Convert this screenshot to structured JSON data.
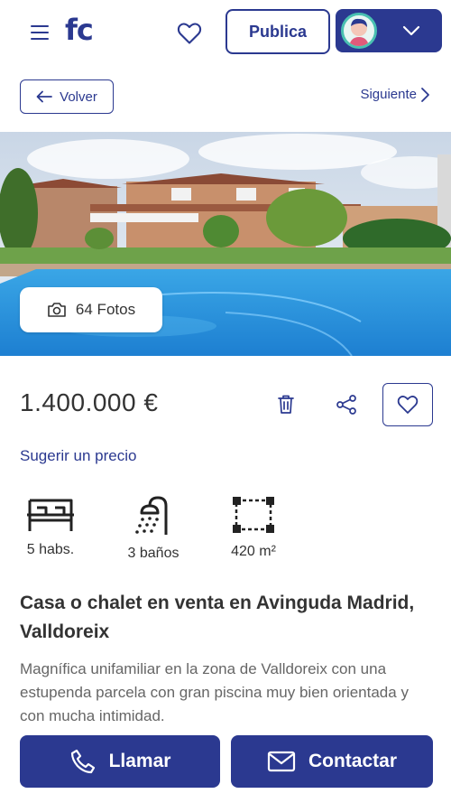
{
  "header": {
    "logo": "fc",
    "publish_label": "Publica"
  },
  "nav": {
    "back_label": "Volver",
    "next_label": "Siguiente"
  },
  "gallery": {
    "photos_label": "64 Fotos"
  },
  "listing": {
    "price": "1.400.000 €",
    "suggest_price_label": "Sugerir un precio",
    "features": [
      {
        "icon": "bed-icon",
        "label": "5 habs."
      },
      {
        "icon": "shower-icon",
        "label": "3 baños"
      },
      {
        "icon": "area-icon",
        "label": "420 m²"
      }
    ],
    "title": "Casa o chalet en venta en Avinguda Madrid, Valldoreix",
    "description": "Magnífica unifamiliar en la zona de Valldoreix con una estupenda parcela con gran piscina muy bien orientada y con mucha intimidad."
  },
  "actions": {
    "call_label": "Llamar",
    "contact_label": "Contactar"
  },
  "colors": {
    "brand": "#2b3990",
    "text": "#333333",
    "muted": "#666666",
    "avatar_ring": "#49c0b1"
  }
}
